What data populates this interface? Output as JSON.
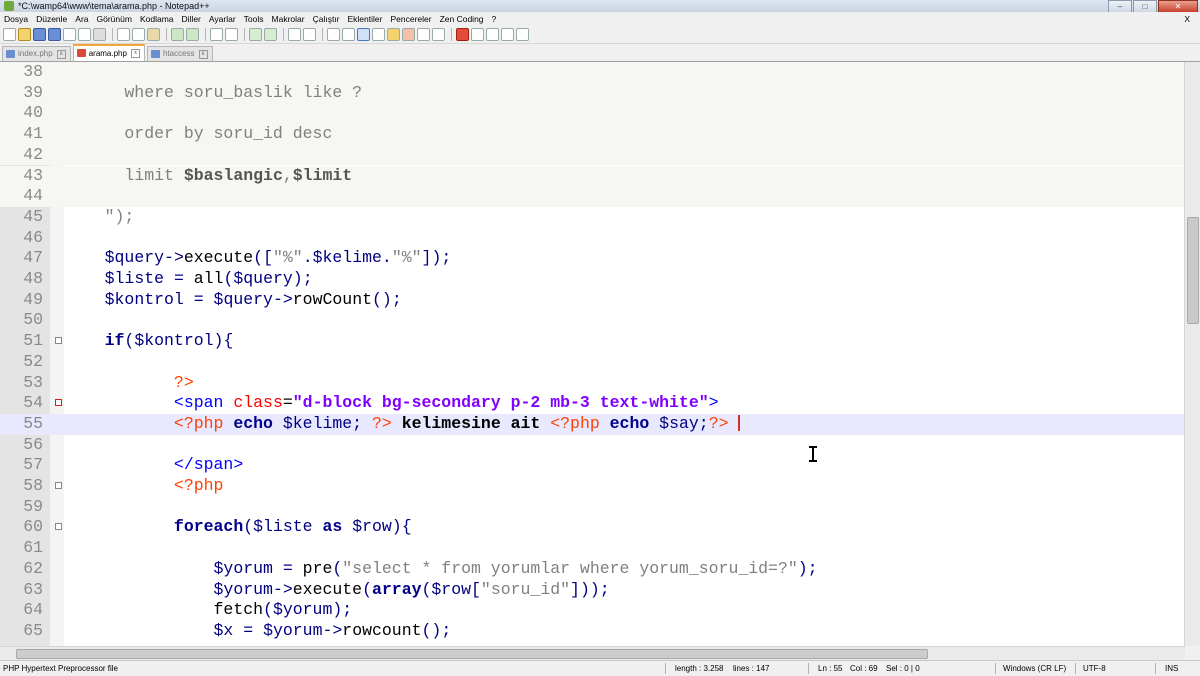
{
  "window": {
    "title": "*C:\\wamp64\\www\\tema\\arama.php - Notepad++",
    "minimize": "–",
    "maximize": "□",
    "close": "✕"
  },
  "menu": [
    "Dosya",
    "Düzenle",
    "Ara",
    "Görünüm",
    "Kodlama",
    "Diller",
    "Ayarlar",
    "Tools",
    "Makrolar",
    "Çalıştır",
    "Eklentiler",
    "Pencereler",
    "Zen Coding",
    "?"
  ],
  "menu_close": "X",
  "tabs": [
    {
      "label": "index.php",
      "close": "x"
    },
    {
      "label": "arama.php",
      "close": "x"
    },
    {
      "label": "htaccess",
      "close": "x"
    }
  ],
  "colors": {
    "keyword": "#00008b",
    "string": "#808080",
    "variable": "#000080",
    "php_tag": "#ff4000",
    "html_tag": "#0000ff",
    "attr": "#ff0000",
    "attr_value": "#8000ff"
  },
  "lines": [
    {
      "n": "38",
      "text": ""
    },
    {
      "n": "39",
      "text": "      where soru_baslik like ?"
    },
    {
      "n": "40",
      "text": ""
    },
    {
      "n": "41",
      "text": "      order by soru_id desc"
    },
    {
      "n": "42",
      "text": ""
    },
    {
      "n": "43",
      "text": "      limit $baslangic,$limit"
    },
    {
      "n": "44",
      "text": ""
    },
    {
      "n": "45",
      "text": "    \");"
    },
    {
      "n": "46",
      "text": ""
    },
    {
      "n": "47",
      "text": "    $query->execute([\"%\".$kelime.\"%\"]);"
    },
    {
      "n": "48",
      "text": "    $liste = all($query);"
    },
    {
      "n": "49",
      "text": "    $kontrol = $query->rowCount();"
    },
    {
      "n": "50",
      "text": ""
    },
    {
      "n": "51",
      "text": "    if($kontrol){"
    },
    {
      "n": "52",
      "text": ""
    },
    {
      "n": "53",
      "text": "           ?>"
    },
    {
      "n": "54",
      "text": "           <span class=\"d-block bg-secondary p-2 mb-3 text-white\">"
    },
    {
      "n": "55",
      "text": "           <?php echo $kelime; ?> kelimesine ait <?php echo $say;?> "
    },
    {
      "n": "56",
      "text": ""
    },
    {
      "n": "57",
      "text": "           </span>"
    },
    {
      "n": "58",
      "text": "           <?php"
    },
    {
      "n": "59",
      "text": ""
    },
    {
      "n": "60",
      "text": "           foreach($liste as $row){"
    },
    {
      "n": "61",
      "text": ""
    },
    {
      "n": "62",
      "text": "               $yorum = pre(\"select * from yorumlar where yorum_soru_id=?\");"
    },
    {
      "n": "63",
      "text": "               $yorum->execute(array($row[\"soru_id\"]));"
    },
    {
      "n": "64",
      "text": "               fetch($yorum);"
    },
    {
      "n": "65",
      "text": "               $x = $yorum->rowcount();"
    }
  ],
  "status": {
    "filetype": "PHP Hypertext Preprocessor file",
    "length": "length : 3.258",
    "lines": "lines : 147",
    "ln": "Ln : 55",
    "col": "Col : 69",
    "sel": "Sel : 0 | 0",
    "eol": "Windows (CR LF)",
    "encoding": "UTF-8",
    "mode": "INS"
  }
}
